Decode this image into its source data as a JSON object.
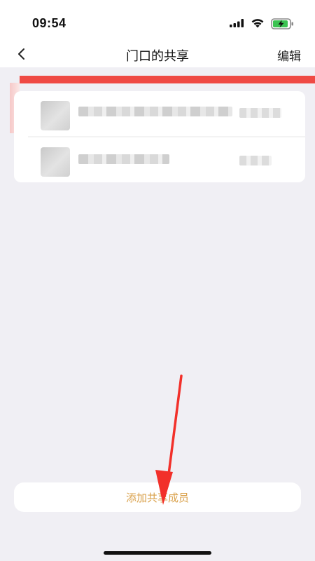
{
  "status_bar": {
    "time": "09:54",
    "icons": [
      "signal-icon",
      "wifi-icon",
      "battery-charging-icon"
    ]
  },
  "nav": {
    "back_icon": "chevron-left-icon",
    "title": "门口的共享",
    "edit_label": "编辑"
  },
  "members": {
    "rows": [
      {
        "name": "",
        "meta": ""
      },
      {
        "name": "",
        "meta": ""
      }
    ]
  },
  "actions": {
    "add_member_label": "添加共享成员"
  },
  "colors": {
    "banner_red": "#ef4a44",
    "accent_orange": "#d9a04a",
    "background": "#f0eff4",
    "annotation_arrow": "#f2302a"
  }
}
